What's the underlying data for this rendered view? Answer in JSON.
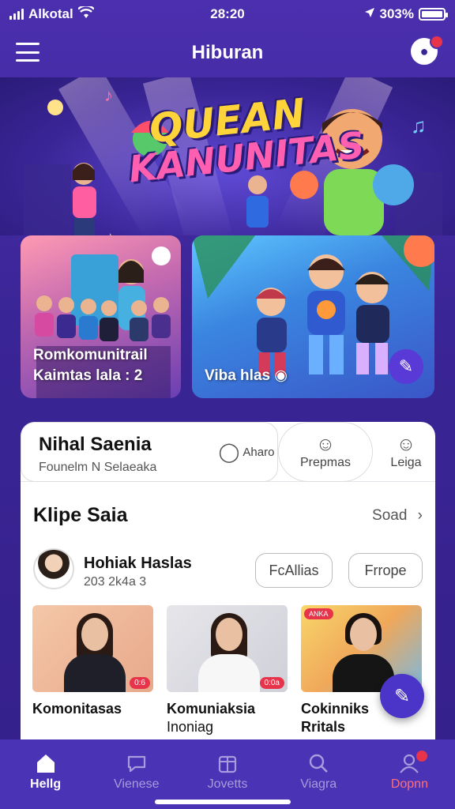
{
  "status": {
    "carrier": "Alkotal",
    "time": "28:20",
    "battery": "303%"
  },
  "header": {
    "title": "Hiburan"
  },
  "hero": {
    "line1": "QUEAN",
    "line2": "KANUNITAS"
  },
  "features": [
    {
      "label_line1": "Romkomunitrail",
      "label_line2": "Kaimtas lala : 2"
    },
    {
      "label_line1": "Viba hlas",
      "label_line2": ""
    }
  ],
  "tabs": {
    "main_title": "Nihal Saenia",
    "main_subtitle": "Founelm  N Selaeaka",
    "t1": "Aharo",
    "t2": "Prepmas",
    "t3": "Leiga"
  },
  "section": {
    "title": "Klipe Saia",
    "see_all": "Soad"
  },
  "profile": {
    "name": "Hohiak Haslas",
    "meta": "203  2k4a 3",
    "btn1": "FcAllias",
    "btn2": "Frrope"
  },
  "thumbs": [
    {
      "caption_line1": "Komonitasas",
      "caption_line2": "",
      "tag": "0:6"
    },
    {
      "caption_line1": "Komuniaksia",
      "caption_line2": "Inoniag",
      "tag": "0:0a"
    },
    {
      "caption_line1": "Cokinniks",
      "caption_line2": "Rritals",
      "tag": "ANKA"
    }
  ],
  "nav": [
    {
      "label": "Hellg",
      "icon": "home-icon"
    },
    {
      "label": "Vienese",
      "icon": "chat-icon"
    },
    {
      "label": "Jovetts",
      "icon": "calendar-icon"
    },
    {
      "label": "Viagra",
      "icon": "search-icon"
    },
    {
      "label": "Dopnn",
      "icon": "profile-icon"
    }
  ]
}
